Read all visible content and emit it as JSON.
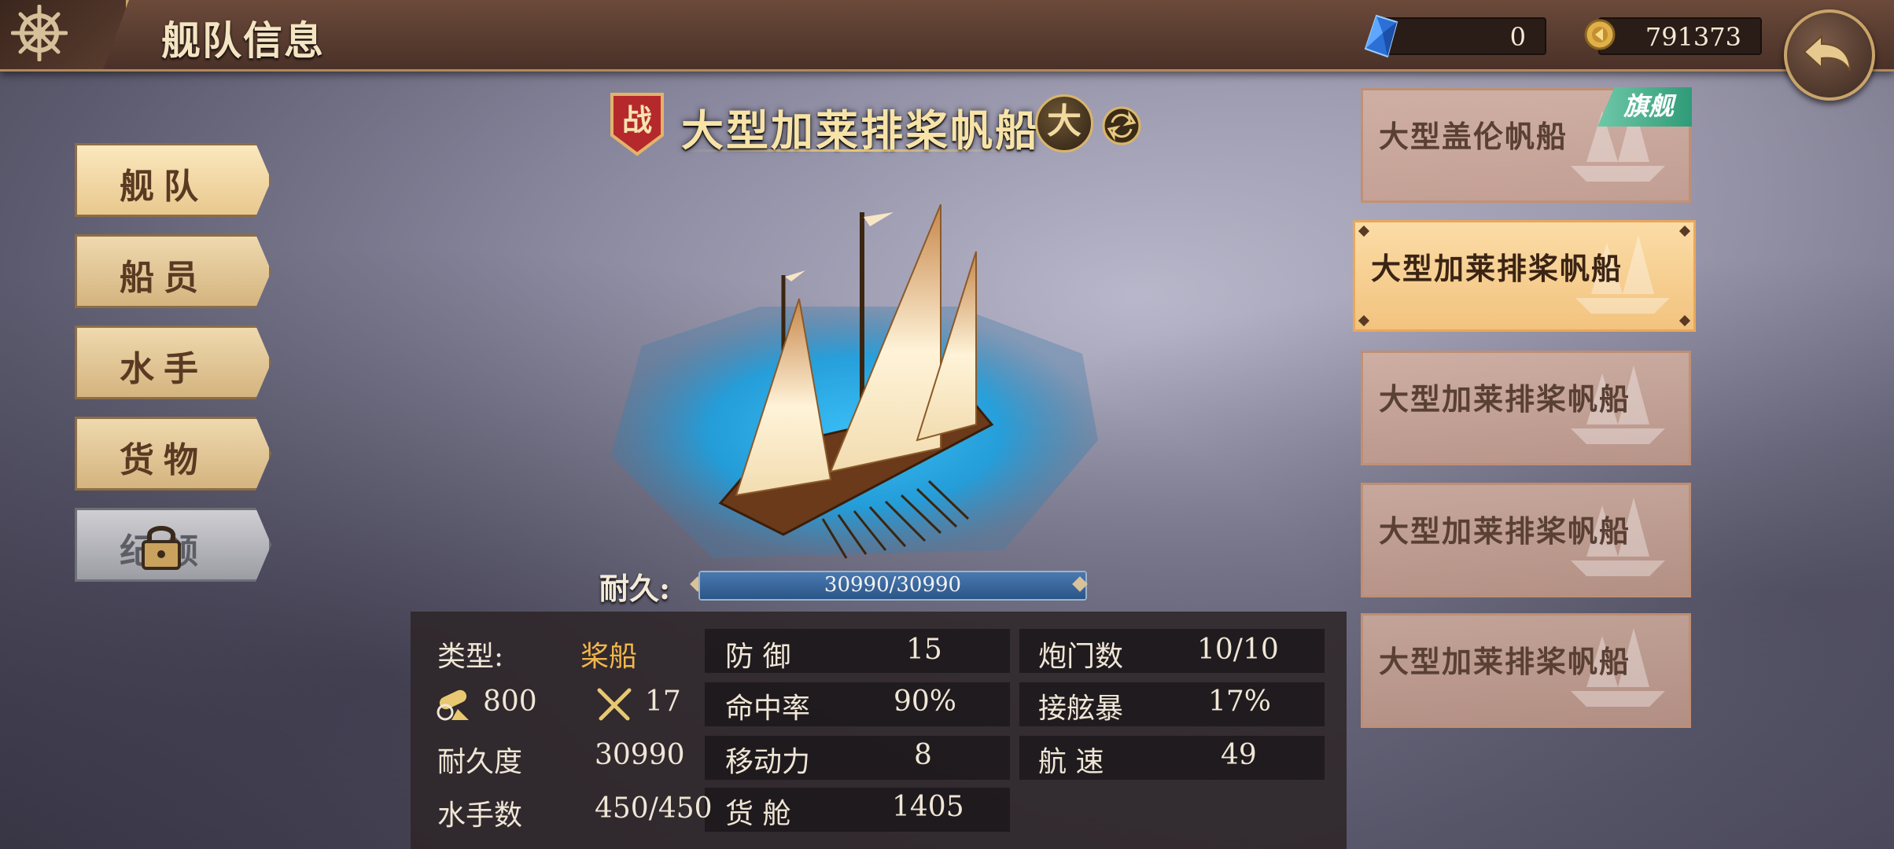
{
  "header": {
    "title": "舰队信息",
    "gems": "0",
    "coins": "791373"
  },
  "menu": {
    "items": [
      {
        "label": "舰队",
        "active": true,
        "locked": false
      },
      {
        "label": "船员",
        "active": false,
        "locked": false
      },
      {
        "label": "水手",
        "active": false,
        "locked": false
      },
      {
        "label": "货物",
        "active": false,
        "locked": false
      },
      {
        "label": "纪领",
        "active": false,
        "locked": true
      }
    ]
  },
  "ship": {
    "battle_badge": "战",
    "name": "大型加莱排桨帆船",
    "size_badge": "大",
    "durability_label": "耐久:",
    "durability_current": 30990,
    "durability_max": 30990,
    "durability_text": "30990/30990"
  },
  "stats": {
    "type_label": "类型:",
    "type_value": "桨船",
    "cannon_value": "800",
    "melee_value": "17",
    "durability_label": "耐久度",
    "durability_value": "30990",
    "crew_label": "水手数",
    "crew_value": "450/450",
    "defense_label": "防 御",
    "defense_value": "15",
    "accuracy_label": "命中率",
    "accuracy_value": "90%",
    "mobility_label": "移动力",
    "mobility_value": "8",
    "cargo_label": "货 舱",
    "cargo_value": "1405",
    "gunports_label": "炮门数",
    "gunports_value": "10/10",
    "boarding_label": "接舷暴",
    "boarding_value": "17%",
    "speed_label": "航 速",
    "speed_value": "49"
  },
  "fleet": {
    "flagship_tag": "旗舰",
    "ships": [
      {
        "name": "大型盖伦帆船",
        "flagship": true,
        "selected": false
      },
      {
        "name": "大型加莱排桨帆船",
        "flagship": false,
        "selected": true
      },
      {
        "name": "大型加莱排桨帆船",
        "flagship": false,
        "selected": false
      },
      {
        "name": "大型加莱排桨帆船",
        "flagship": false,
        "selected": false
      },
      {
        "name": "大型加莱排桨帆船",
        "flagship": false,
        "selected": false
      }
    ]
  },
  "icons": {
    "header": "ship-wheel-icon",
    "gem": "blue-gem-icon",
    "coin": "gold-coin-icon",
    "back": "back-arrow-icon",
    "lock": "padlock-icon",
    "swap": "swap-icon",
    "cannon": "cannon-icon",
    "melee": "crossed-swords-icon"
  },
  "colors": {
    "accent_gold": "#f7e3a7",
    "type_orange": "#f2b64c",
    "flag_green": "#2f9b78",
    "selected_card": "#f2c37e"
  }
}
